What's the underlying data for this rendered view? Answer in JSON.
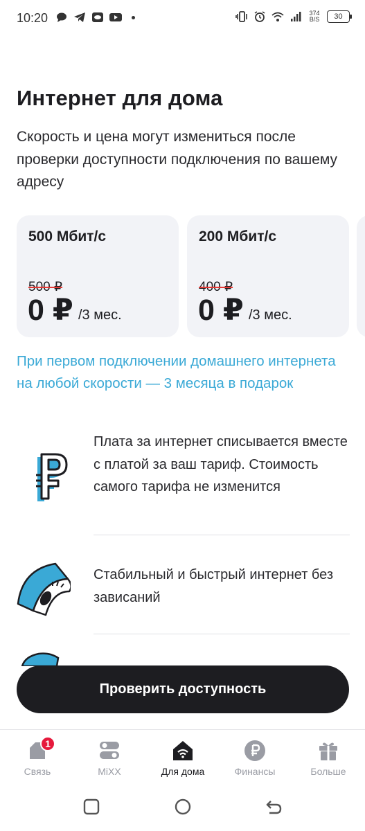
{
  "status_bar": {
    "time": "10:20",
    "net_speed_value": "374",
    "net_speed_unit": "B/S",
    "battery": "30",
    "icons_left": [
      "chat-icon",
      "telegram-icon",
      "cast-icon",
      "youtube-icon",
      "dot-icon"
    ],
    "icons_right": [
      "vibrate-icon",
      "alarm-icon",
      "wifi-icon",
      "signal-icon",
      "battery-icon"
    ]
  },
  "header": {
    "title": "Интернет для дома",
    "subtitle": "Скорость и цена могут измениться после проверки доступности подключения по вашему адресу"
  },
  "tariffs": [
    {
      "speed": "500 Мбит/с",
      "old_price": "500 ₽",
      "price": "0 ₽",
      "period": "/3 мес."
    },
    {
      "speed": "200 Мбит/с",
      "old_price": "400 ₽",
      "price": "0 ₽",
      "period": "/3 мес."
    }
  ],
  "promo": "При первом подключении домашнего интернета на любой скорости — 3 месяца в подарок",
  "features": [
    {
      "text": "Плата за интернет списывается вместе с платой за ваш тариф. Стоимость самого тарифа не изменится",
      "icon": "ruble-3d-icon"
    },
    {
      "text": "Стабильный и быстрый интернет без зависаний",
      "icon": "speedometer-3d-icon"
    }
  ],
  "cta": {
    "label": "Проверить доступность"
  },
  "bottom_nav": {
    "items": [
      {
        "label": "Связь",
        "icon": "sim-icon",
        "badge": "1"
      },
      {
        "label": "MiXX",
        "icon": "toggles-icon"
      },
      {
        "label": "Для дома",
        "icon": "home-wifi-icon",
        "active": true
      },
      {
        "label": "Финансы",
        "icon": "ruble-coin-icon"
      },
      {
        "label": "Больше",
        "icon": "gift-icon"
      }
    ]
  },
  "colors": {
    "accent_blue": "#3aa9d6",
    "dark": "#1d1d21",
    "card_bg": "#f2f3f7",
    "badge_red": "#e6193c",
    "strike_red": "#e53935",
    "nav_inactive": "#9a9ca4"
  }
}
